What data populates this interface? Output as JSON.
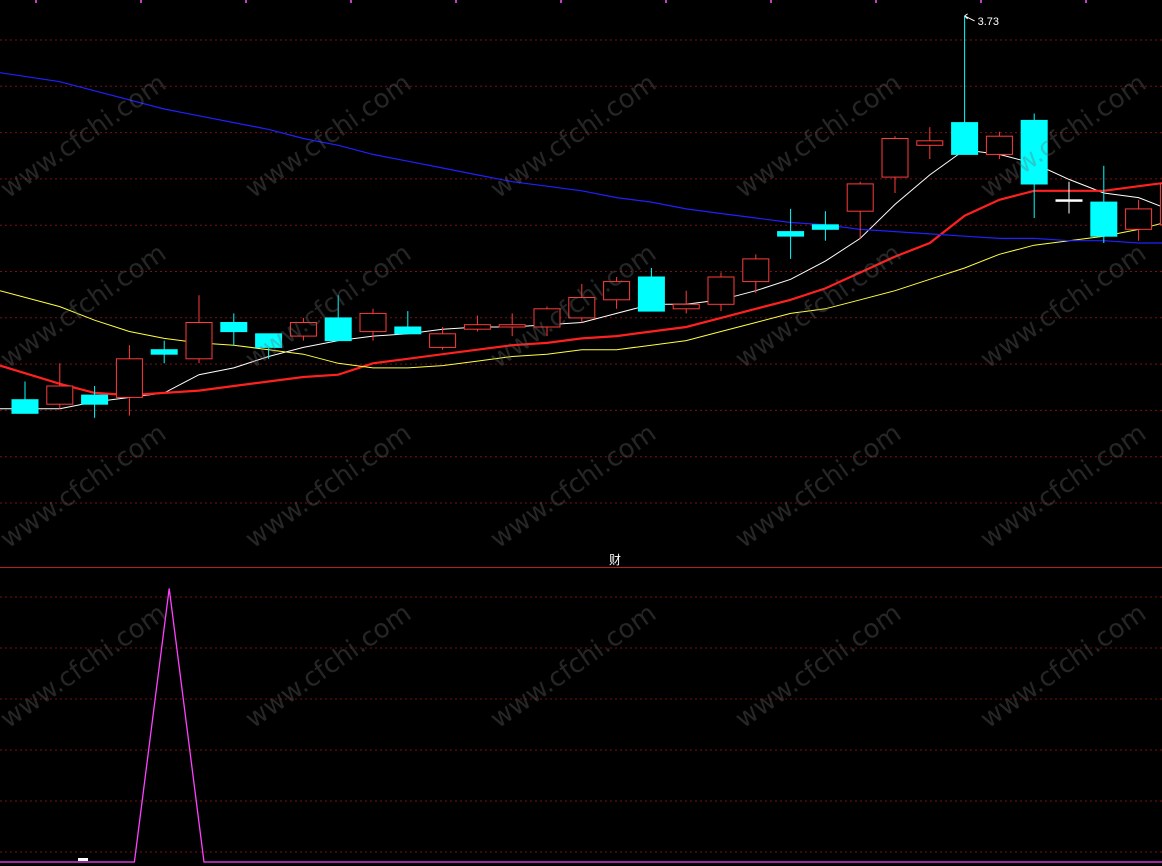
{
  "panel_divider_label": "财",
  "high_marker_label": "3.73",
  "watermark_text": "www.cfchi.com",
  "colors": {
    "background": "#000000",
    "up_candle": "#ff3b3b",
    "down_candle": "#00ffff",
    "ma_short": "#ffffff",
    "ma_mid": "#ff2020",
    "ma_long": "#ffff40",
    "ma_longest": "#2020ff",
    "grid": "#7a1010",
    "indicator": "#ff40ff"
  },
  "chart_data": [
    {
      "type": "candlestick",
      "ylim": [
        1.4,
        3.8
      ],
      "grid": true,
      "candles": [
        {
          "o": 2.04,
          "h": 2.12,
          "l": 1.98,
          "c": 1.98
        },
        {
          "o": 2.02,
          "h": 2.2,
          "l": 2.0,
          "c": 2.1
        },
        {
          "o": 2.06,
          "h": 2.1,
          "l": 1.96,
          "c": 2.02
        },
        {
          "o": 2.05,
          "h": 2.28,
          "l": 1.97,
          "c": 2.22
        },
        {
          "o": 2.26,
          "h": 2.3,
          "l": 2.2,
          "c": 2.24
        },
        {
          "o": 2.22,
          "h": 2.5,
          "l": 2.2,
          "c": 2.38
        },
        {
          "o": 2.38,
          "h": 2.42,
          "l": 2.28,
          "c": 2.34
        },
        {
          "o": 2.33,
          "h": 2.33,
          "l": 2.22,
          "c": 2.27
        },
        {
          "o": 2.32,
          "h": 2.4,
          "l": 2.3,
          "c": 2.38
        },
        {
          "o": 2.4,
          "h": 2.5,
          "l": 2.35,
          "c": 2.3
        },
        {
          "o": 2.34,
          "h": 2.44,
          "l": 2.3,
          "c": 2.42
        },
        {
          "o": 2.36,
          "h": 2.43,
          "l": 2.35,
          "c": 2.33
        },
        {
          "o": 2.27,
          "h": 2.36,
          "l": 2.26,
          "c": 2.33
        },
        {
          "o": 2.35,
          "h": 2.41,
          "l": 2.34,
          "c": 2.37
        },
        {
          "o": 2.36,
          "h": 2.42,
          "l": 2.32,
          "c": 2.37
        },
        {
          "o": 2.36,
          "h": 2.45,
          "l": 2.32,
          "c": 2.44
        },
        {
          "o": 2.4,
          "h": 2.55,
          "l": 2.38,
          "c": 2.49
        },
        {
          "o": 2.48,
          "h": 2.58,
          "l": 2.44,
          "c": 2.56
        },
        {
          "o": 2.58,
          "h": 2.62,
          "l": 2.43,
          "c": 2.43
        },
        {
          "o": 2.44,
          "h": 2.52,
          "l": 2.42,
          "c": 2.46
        },
        {
          "o": 2.46,
          "h": 2.6,
          "l": 2.43,
          "c": 2.58
        },
        {
          "o": 2.56,
          "h": 2.68,
          "l": 2.51,
          "c": 2.66
        },
        {
          "o": 2.78,
          "h": 2.88,
          "l": 2.66,
          "c": 2.76
        },
        {
          "o": 2.81,
          "h": 2.87,
          "l": 2.74,
          "c": 2.79
        },
        {
          "o": 2.87,
          "h": 3.0,
          "l": 2.75,
          "c": 2.99
        },
        {
          "o": 3.02,
          "h": 3.2,
          "l": 2.95,
          "c": 3.19
        },
        {
          "o": 3.16,
          "h": 3.24,
          "l": 3.1,
          "c": 3.18
        },
        {
          "o": 3.26,
          "h": 3.73,
          "l": 3.12,
          "c": 3.12
        },
        {
          "o": 3.12,
          "h": 3.22,
          "l": 3.1,
          "c": 3.2
        },
        {
          "o": 3.27,
          "h": 3.3,
          "l": 2.84,
          "c": 2.99
        },
        {
          "o": 2.92,
          "h": 3.0,
          "l": 2.86,
          "c": 2.92
        },
        {
          "o": 2.91,
          "h": 3.07,
          "l": 2.73,
          "c": 2.76
        },
        {
          "o": 2.79,
          "h": 2.92,
          "l": 2.74,
          "c": 2.88
        },
        {
          "o": 2.81,
          "h": 3.01,
          "l": 2.73,
          "c": 2.99
        },
        {
          "o": 2.97,
          "h": 3.1,
          "l": 2.92,
          "c": 3.09
        }
      ],
      "moving_averages": [
        {
          "name": "MA_short",
          "values": [
            2.0,
            2.0,
            2.03,
            2.05,
            2.07,
            2.15,
            2.18,
            2.23,
            2.27,
            2.3,
            2.32,
            2.33,
            2.35,
            2.36,
            2.36,
            2.37,
            2.38,
            2.42,
            2.46,
            2.46,
            2.48,
            2.52,
            2.57,
            2.65,
            2.75,
            2.9,
            3.03,
            3.14,
            3.12,
            3.08,
            3.01,
            2.95,
            2.93,
            2.87,
            2.9
          ]
        },
        {
          "name": "MA_mid",
          "values": [
            2.19,
            2.11,
            2.07,
            2.06,
            2.07,
            2.08,
            2.1,
            2.12,
            2.14,
            2.15,
            2.2,
            2.22,
            2.24,
            2.26,
            2.28,
            2.29,
            2.31,
            2.32,
            2.34,
            2.36,
            2.4,
            2.44,
            2.48,
            2.53,
            2.6,
            2.67,
            2.73,
            2.85,
            2.92,
            2.96,
            2.96,
            2.96,
            2.98,
            3.0,
            3.02
          ]
        },
        {
          "name": "MA_long",
          "values": [
            2.52,
            2.45,
            2.39,
            2.34,
            2.31,
            2.29,
            2.28,
            2.26,
            2.24,
            2.2,
            2.18,
            2.18,
            2.19,
            2.21,
            2.23,
            2.24,
            2.26,
            2.26,
            2.28,
            2.3,
            2.34,
            2.38,
            2.42,
            2.44,
            2.48,
            2.52,
            2.57,
            2.62,
            2.68,
            2.72,
            2.74,
            2.76,
            2.79,
            2.83,
            2.88
          ]
        },
        {
          "name": "MA_longest",
          "values": [
            3.48,
            3.44,
            3.4,
            3.36,
            3.32,
            3.29,
            3.26,
            3.23,
            3.19,
            3.16,
            3.12,
            3.09,
            3.06,
            3.03,
            3.0,
            2.98,
            2.96,
            2.93,
            2.91,
            2.88,
            2.86,
            2.84,
            2.82,
            2.81,
            2.79,
            2.78,
            2.77,
            2.76,
            2.75,
            2.75,
            2.74,
            2.74,
            2.73,
            2.73,
            2.73
          ]
        }
      ]
    },
    {
      "type": "line",
      "series": [
        {
          "values": [
            0,
            0,
            0,
            0,
            1,
            0,
            0,
            0,
            0,
            0,
            0,
            0,
            0,
            0,
            0,
            0,
            0,
            0,
            0,
            0,
            0,
            0,
            0,
            0,
            0,
            0,
            0,
            0,
            0,
            0,
            0,
            0,
            0,
            0,
            0
          ]
        }
      ],
      "ylim": [
        0,
        1.06
      ],
      "grid": true
    }
  ]
}
